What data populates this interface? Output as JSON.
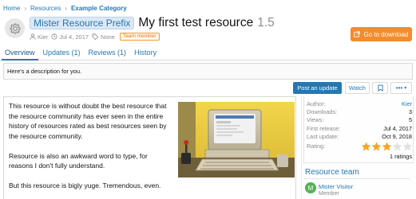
{
  "breadcrumb": {
    "items": [
      "Home",
      "Resources",
      "Example Category"
    ]
  },
  "resource": {
    "prefix": "Mister Resource Prefix",
    "title": "My first test resource",
    "version": "1.5",
    "author": "Kier",
    "date": "Jul 4, 2017",
    "tags": "None",
    "badge": "Team member"
  },
  "download_label": "Go to download",
  "tabs": [
    {
      "label": "Overview",
      "active": true
    },
    {
      "label": "Updates (1)",
      "active": false
    },
    {
      "label": "Reviews (1)",
      "active": false
    },
    {
      "label": "History",
      "active": false
    }
  ],
  "description": "Here's a description for you.",
  "actions": {
    "post_update": "Post an update",
    "watch": "Watch",
    "more": "•••"
  },
  "body": {
    "paragraphs": [
      "This resource is without doubt the best resource that the resource community has ever seen in the entire history of resources rated as best resources seen by the resource community.",
      "Resource is also an awkward word to type, for reasons I don't fully understand.",
      "But this resource is bigly yuge. Tremendous, even."
    ]
  },
  "info": {
    "author_label": "Author:",
    "author_value": "Kier",
    "downloads_label": "Downloads:",
    "downloads_value": "3",
    "views_label": "Views:",
    "views_value": "5",
    "first_release_label": "First release:",
    "first_release_value": "Jul 4, 2017",
    "last_update_label": "Last update:",
    "last_update_value": "Oct 9, 2018",
    "rating_label": "Rating:",
    "rating_value": 3,
    "rating_max": 5,
    "ratings_count": "1 ratings"
  },
  "team": {
    "heading": "Resource team",
    "member_initial": "M",
    "member_name": "Mister Visitor",
    "member_role": "Member"
  },
  "colors": {
    "accent": "#2577b1",
    "download": "#f28d2d",
    "star": "#f5a623",
    "avatar": "#52b352"
  }
}
